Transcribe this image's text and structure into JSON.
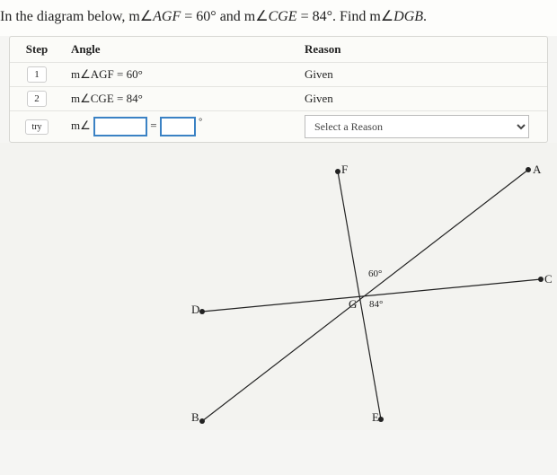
{
  "prompt": {
    "prefix": "In the diagram below,  m∠",
    "ang1_name": "AGF",
    "eq1": " = 60° and m∠",
    "ang2_name": "CGE",
    "eq2": " = 84°. Find m∠",
    "target": "DGB",
    "suffix": "."
  },
  "table": {
    "header_step": "Step",
    "header_angle": "Angle",
    "header_reason": "Reason",
    "rows": [
      {
        "step": "1",
        "angle": "m∠AGF = 60°",
        "reason": "Given"
      },
      {
        "step": "2",
        "angle": "m∠CGE = 84°",
        "reason": "Given"
      }
    ],
    "try_label": "try",
    "m_prefix": "m∠",
    "equals": "=",
    "deg": "°",
    "reason_placeholder": "Select a Reason"
  },
  "diagram": {
    "points": {
      "A": "A",
      "B": "B",
      "C": "C",
      "D": "D",
      "E": "E",
      "F": "F",
      "G": "G"
    },
    "angle60": "60°",
    "angle84": "84°"
  }
}
